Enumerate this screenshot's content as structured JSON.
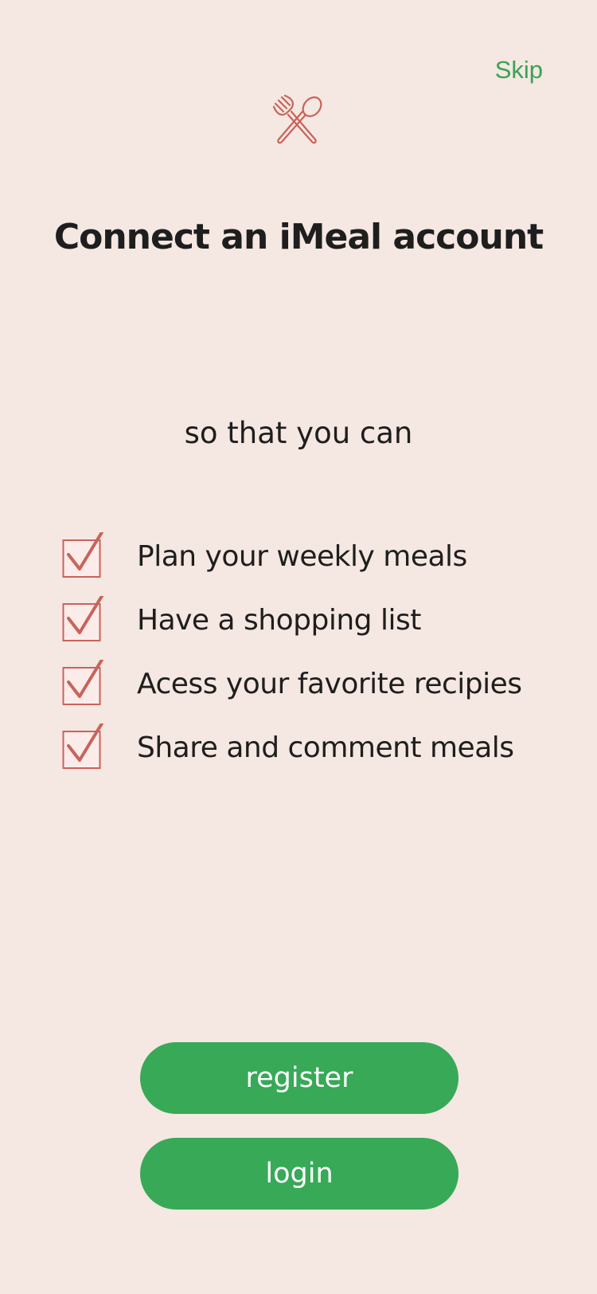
{
  "header": {
    "skip_label": "Skip",
    "logo_icon": "fork-spoon-icon"
  },
  "title": "Connect an iMeal account",
  "subtitle": "so that you can",
  "features": [
    {
      "label": "Plan your weekly meals",
      "checked": true
    },
    {
      "label": "Have a shopping list",
      "checked": true
    },
    {
      "label": "Acess your favorite recipies",
      "checked": true
    },
    {
      "label": "Share and comment meals",
      "checked": true
    }
  ],
  "actions": {
    "register_label": "register",
    "login_label": "login"
  },
  "colors": {
    "background": "#f5e7e1",
    "accent_green": "#37a957",
    "accent_red": "#c9635a",
    "text": "#1e1e1e"
  }
}
